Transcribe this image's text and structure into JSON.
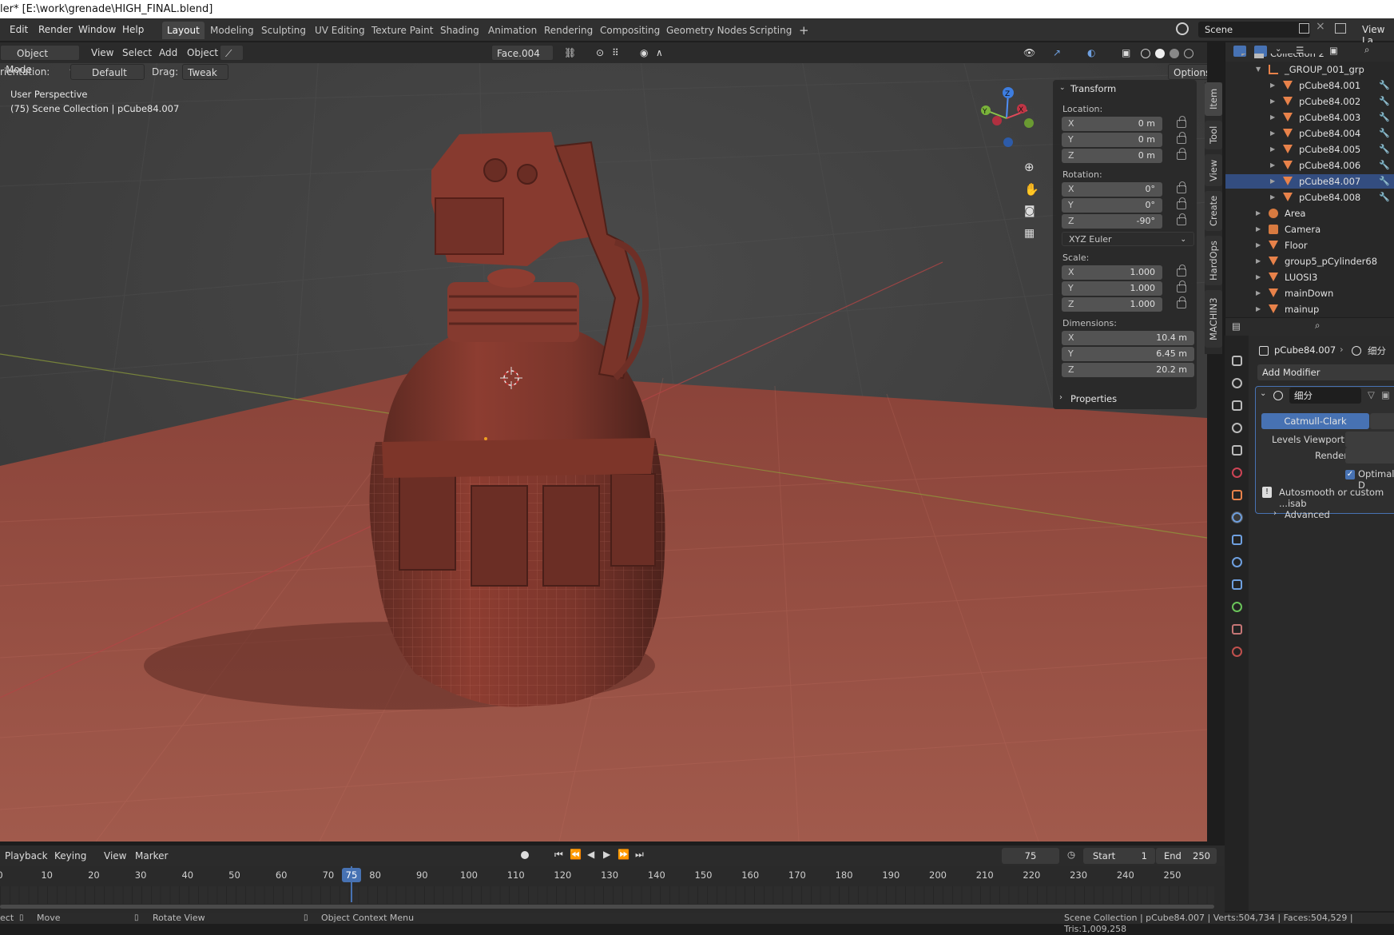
{
  "window": {
    "title": "ler* [E:\\work\\grenade\\HIGH_FINAL.blend]"
  },
  "menu": {
    "items": [
      "Edit",
      "Render",
      "Window",
      "Help"
    ]
  },
  "workspaces": [
    "Layout",
    "Modeling",
    "Sculpting",
    "UV Editing",
    "Texture Paint",
    "Shading",
    "Animation",
    "Rendering",
    "Compositing",
    "Geometry Nodes",
    "Scripting"
  ],
  "workspace_add": "+",
  "scene": {
    "name": "Scene",
    "view_layer": "View La"
  },
  "viewport_header": {
    "mode": "Object Mode",
    "menus": [
      "View",
      "Select",
      "Add",
      "Object"
    ],
    "selected_face": "Face.004",
    "orientation_label": "rientation:",
    "orientation_value": "Default",
    "drag_label": "Drag:",
    "drag_value": "Tweak",
    "options": "Options"
  },
  "viewport_info": {
    "line1": "User Perspective",
    "line2": "(75) Scene Collection | pCube84.007"
  },
  "gizmo": {
    "x": "X",
    "y": "Y",
    "z": "Z"
  },
  "npanel": {
    "transform_title": "Transform",
    "location_label": "Location:",
    "location": [
      {
        "axis": "X",
        "value": "0 m"
      },
      {
        "axis": "Y",
        "value": "0 m"
      },
      {
        "axis": "Z",
        "value": "0 m"
      }
    ],
    "rotation_label": "Rotation:",
    "rotation": [
      {
        "axis": "X",
        "value": "0°"
      },
      {
        "axis": "Y",
        "value": "0°"
      },
      {
        "axis": "Z",
        "value": "-90°"
      }
    ],
    "rotation_mode": "XYZ Euler",
    "scale_label": "Scale:",
    "scale": [
      {
        "axis": "X",
        "value": "1.000"
      },
      {
        "axis": "Y",
        "value": "1.000"
      },
      {
        "axis": "Z",
        "value": "1.000"
      }
    ],
    "dimensions_label": "Dimensions:",
    "dimensions": [
      {
        "axis": "X",
        "value": "10.4 m"
      },
      {
        "axis": "Y",
        "value": "6.45 m"
      },
      {
        "axis": "Z",
        "value": "20.2 m"
      }
    ],
    "properties_title": "Properties"
  },
  "side_tabs": [
    "Item",
    "Tool",
    "View",
    "Create",
    "HardOps",
    "MACHIN3"
  ],
  "outliner": {
    "rows": [
      {
        "label": "Collection 2",
        "indent": 1,
        "kind": "collection"
      },
      {
        "label": "_GROUP_001_grp",
        "indent": 2,
        "kind": "empty"
      },
      {
        "label": "pCube84.001",
        "indent": 3,
        "kind": "mesh"
      },
      {
        "label": "pCube84.002",
        "indent": 3,
        "kind": "mesh"
      },
      {
        "label": "pCube84.003",
        "indent": 3,
        "kind": "mesh"
      },
      {
        "label": "pCube84.004",
        "indent": 3,
        "kind": "mesh"
      },
      {
        "label": "pCube84.005",
        "indent": 3,
        "kind": "mesh"
      },
      {
        "label": "pCube84.006",
        "indent": 3,
        "kind": "mesh"
      },
      {
        "label": "pCube84.007",
        "indent": 3,
        "kind": "mesh",
        "selected": true
      },
      {
        "label": "pCube84.008",
        "indent": 3,
        "kind": "mesh"
      },
      {
        "label": "Area",
        "indent": 2,
        "kind": "light"
      },
      {
        "label": "Camera",
        "indent": 2,
        "kind": "camera"
      },
      {
        "label": "Floor",
        "indent": 2,
        "kind": "mesh"
      },
      {
        "label": "group5_pCylinder68",
        "indent": 2,
        "kind": "mesh"
      },
      {
        "label": "LUOSI3",
        "indent": 2,
        "kind": "mesh"
      },
      {
        "label": "mainDown",
        "indent": 2,
        "kind": "mesh"
      },
      {
        "label": "mainup",
        "indent": 2,
        "kind": "mesh"
      }
    ]
  },
  "properties": {
    "object": "pCube84.007",
    "modifier_breadcrumb": "细分",
    "add_modifier": "Add Modifier",
    "modifier_name": "细分",
    "catmull": "Catmull-Clark",
    "levels_viewport": "Levels Viewport",
    "render": "Render",
    "optimal": "Optimal D",
    "warning": "Autosmooth or custom ...isab",
    "advanced": "Advanced"
  },
  "timeline": {
    "menus": [
      "Playback",
      "Keying",
      "View",
      "Marker"
    ],
    "current_frame": "75",
    "start_label": "Start",
    "start": "1",
    "end_label": "End",
    "end": "250",
    "ticks": [
      "0",
      "10",
      "20",
      "30",
      "40",
      "50",
      "60",
      "70",
      "80",
      "90",
      "100",
      "110",
      "120",
      "130",
      "140",
      "150",
      "160",
      "170",
      "180",
      "190",
      "200",
      "210",
      "220",
      "230",
      "240",
      "250"
    ]
  },
  "status": {
    "select": "ect",
    "move": "Move",
    "rotate": "Rotate View",
    "context": "Object Context Menu",
    "stats": "Scene Collection | pCube84.007 | Verts:504,734 | Faces:504,529 | Tris:1,009,258"
  },
  "colors": {
    "accent": "#4772b3",
    "model": "#8c3a2f",
    "floor": "#9a4a3f"
  }
}
